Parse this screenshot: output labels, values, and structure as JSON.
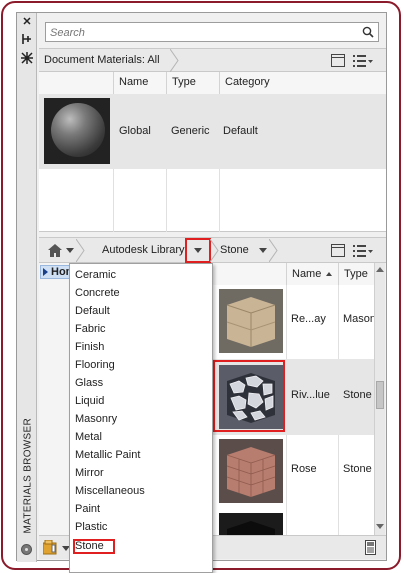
{
  "palette": {
    "title": "MATERIALS BROWSER",
    "controls": [
      "close-icon",
      "pin-icon",
      "properties-icon"
    ]
  },
  "search": {
    "placeholder": "Search",
    "value": ""
  },
  "document": {
    "breadcrumb": "Document Materials: All",
    "columns": [
      "Name",
      "Type",
      "Category"
    ],
    "rows": [
      {
        "name": "Global",
        "type": "Generic",
        "category": "Default",
        "swatch": "sphere-gray"
      }
    ]
  },
  "library": {
    "crumbs": [
      "Autodesk Library",
      "Stone"
    ],
    "tree_item": "Home",
    "columns": [
      "Name",
      "Type"
    ],
    "sort_indicator": "ascending",
    "rows": [
      {
        "name": "Re...ay",
        "type": "Mason",
        "swatch": "tan-block"
      },
      {
        "name": "Riv...lue",
        "type": "Stone",
        "swatch": "river-stone",
        "highlighted": true
      },
      {
        "name": "Rose",
        "type": "Stone",
        "swatch": "rose-brick"
      },
      {
        "name": "",
        "type": "",
        "swatch": "dark-block"
      }
    ]
  },
  "category_menu": {
    "items": [
      "Ceramic",
      "Concrete",
      "Default",
      "Fabric",
      "Finish",
      "Flooring",
      "Glass",
      "Liquid",
      "Masonry",
      "Metal",
      "Metallic Paint",
      "Mirror",
      "Miscellaneous",
      "Paint",
      "Plastic",
      "Stone"
    ],
    "selected": "Stone"
  },
  "colors": {
    "highlight_border": "#e02020",
    "frame_border": "#8b1a2b",
    "selection_blue": "#cfe0f5"
  }
}
